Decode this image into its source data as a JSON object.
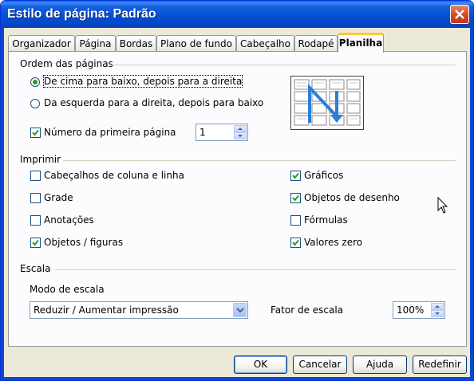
{
  "window": {
    "title": "Estilo de página: Padrão"
  },
  "tabs": [
    "Organizador",
    "Página",
    "Bordas",
    "Plano de fundo",
    "Cabeçalho",
    "Rodapé",
    "Planilha"
  ],
  "active_tab": "Planilha",
  "page_order": {
    "label": "Ordem das páginas",
    "options": [
      {
        "label": "De cima para baixo, depois para a direita",
        "selected": true
      },
      {
        "label": "Da esquerda para a direita, depois para baixo",
        "selected": false
      }
    ],
    "first_page_number": {
      "label": "Número da primeira página",
      "checked": true,
      "value": "1"
    }
  },
  "print": {
    "label": "Imprimir",
    "left": [
      {
        "label": "Cabeçalhos de coluna e linha",
        "checked": false
      },
      {
        "label": "Grade",
        "checked": false
      },
      {
        "label": "Anotações",
        "checked": false
      },
      {
        "label": "Objetos / figuras",
        "checked": true
      }
    ],
    "right": [
      {
        "label": "Gráficos",
        "checked": true
      },
      {
        "label": "Objetos de desenho",
        "checked": true
      },
      {
        "label": "Fórmulas",
        "checked": false
      },
      {
        "label": "Valores zero",
        "checked": true
      }
    ]
  },
  "scale": {
    "label": "Escala",
    "mode_label": "Modo de escala",
    "mode_value": "Reduzir / Aumentar impressão",
    "factor_label": "Fator de escala",
    "factor_value": "100%"
  },
  "buttons": {
    "ok": "OK",
    "cancel": "Cancelar",
    "help": "Ajuda",
    "reset": "Redefinir"
  },
  "colors": {
    "title_bar": "#0552d6",
    "dialog_bg": "#ece9d8",
    "active_tab_accent": "#ffc83c",
    "check": "#21a121",
    "arrow": "#2b7fd9"
  }
}
